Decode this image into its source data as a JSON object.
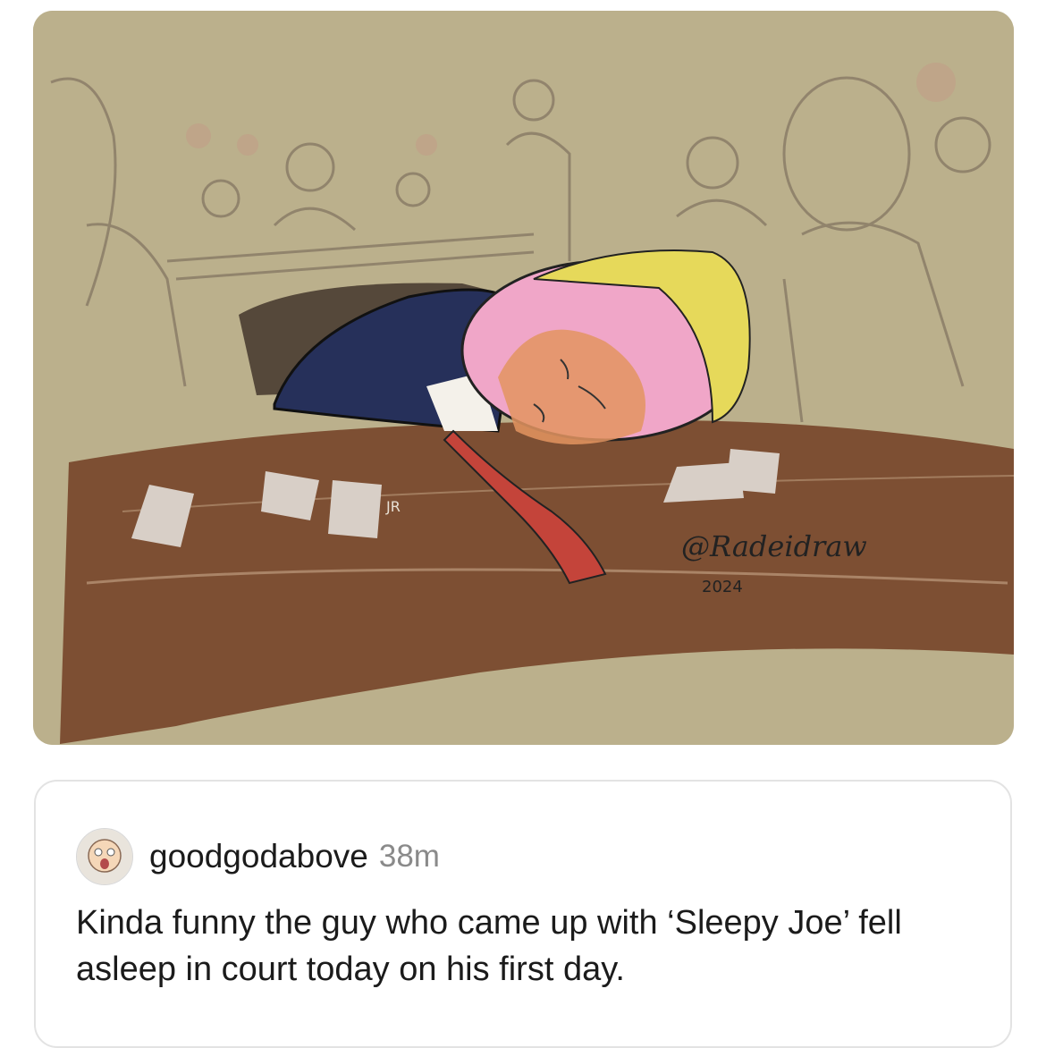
{
  "artwork": {
    "signature": "@Radeidraw",
    "year": "2024",
    "initials": "JR",
    "colors": {
      "background": "#bbb08c",
      "table": "#7d4f33",
      "suit": "#26305a",
      "tie": "#c4443a",
      "hair": "#e6d95a",
      "face_pink": "#f0a6c8"
    }
  },
  "comment": {
    "username": "goodgodabove",
    "time": "38m",
    "text": "Kinda funny the guy who came up with ‘Sleepy Joe’ fell asleep in court today on his first day."
  }
}
